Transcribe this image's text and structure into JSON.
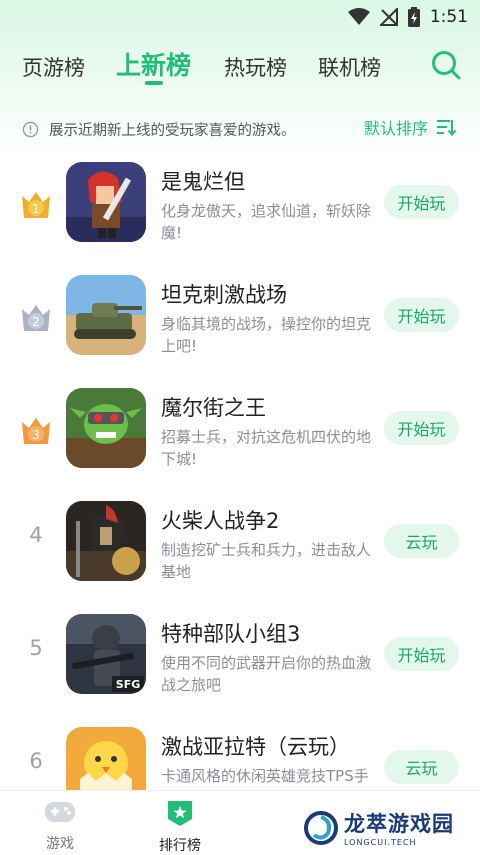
{
  "status_bar": {
    "time": "1:51"
  },
  "tabs": [
    {
      "label": "页游榜",
      "active": false
    },
    {
      "label": "上新榜",
      "active": true
    },
    {
      "label": "热玩榜",
      "active": false
    },
    {
      "label": "联机榜",
      "active": false
    }
  ],
  "notice": {
    "text": "展示近期新上线的受玩家喜爱的游戏。",
    "sort_label": "默认排序"
  },
  "games": [
    {
      "rank": "1",
      "title": "是鬼烂但",
      "desc": "化身龙傲天，追求仙道，斩妖除魔!",
      "action": "开始玩"
    },
    {
      "rank": "2",
      "title": "坦克刺激战场",
      "desc": "身临其境的战场，操控你的坦克上吧!",
      "action": "开始玩"
    },
    {
      "rank": "3",
      "title": "魔尔街之王",
      "desc": "招募士兵，对抗这危机四伏的地下城!",
      "action": "开始玩"
    },
    {
      "rank": "4",
      "title": "火柴人战争2",
      "desc": "制造挖矿士兵和兵力，进击敌人基地",
      "action": "云玩"
    },
    {
      "rank": "5",
      "title": "特种部队小组3",
      "desc": "使用不同的武器开启你的热血激战之旅吧",
      "action": "开始玩"
    },
    {
      "rank": "6",
      "title": "激战亚拉特（云玩）",
      "desc": "卡通风格的休闲英雄竞技TPS手游",
      "action": "云玩"
    }
  ],
  "thumb_badges": {
    "sfg": "SFG"
  },
  "bottom_nav": [
    {
      "label": "游戏",
      "active": false
    },
    {
      "label": "排行榜",
      "active": true
    }
  ],
  "watermark": {
    "title": "龙萃游戏园",
    "subtitle": "LONGCUI.TECH"
  },
  "colors": {
    "accent": "#1fbf76",
    "gold": "#f0b02c",
    "silver": "#aab3c2",
    "bronze": "#f09a3e"
  }
}
